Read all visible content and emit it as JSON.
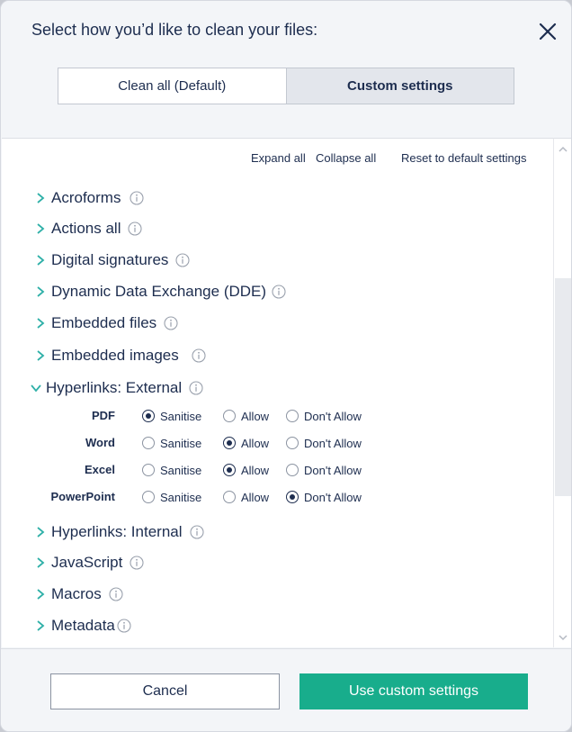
{
  "header": {
    "title": "Select how you’d like to clean your files:",
    "tabs": [
      "Clean all (Default)",
      "Custom settings"
    ],
    "active_tab": "Custom settings"
  },
  "actions": {
    "expand_all": "Expand all",
    "collapse_all": "Collapse all",
    "reset": "Reset to default settings"
  },
  "categories": [
    {
      "label": "Acroforms",
      "expanded": false
    },
    {
      "label": "Actions all",
      "expanded": false
    },
    {
      "label": "Digital signatures",
      "expanded": false
    },
    {
      "label": "Dynamic Data Exchange (DDE)",
      "expanded": false
    },
    {
      "label": "Embedded files",
      "expanded": false
    },
    {
      "label": "Embedded images",
      "expanded": false
    },
    {
      "label": "Hyperlinks: External",
      "expanded": true
    },
    {
      "label": "Hyperlinks: Internal",
      "expanded": false
    },
    {
      "label": "JavaScript",
      "expanded": false
    },
    {
      "label": "Macros",
      "expanded": false
    },
    {
      "label": "Metadata",
      "expanded": false
    }
  ],
  "hyperlinks_external": {
    "options": [
      "Sanitise",
      "Allow",
      "Don't Allow"
    ],
    "rows": [
      {
        "file_type": "PDF",
        "selected": "Sanitise"
      },
      {
        "file_type": "Word",
        "selected": "Allow"
      },
      {
        "file_type": "Excel",
        "selected": "Allow"
      },
      {
        "file_type": "PowerPoint",
        "selected": "Don't Allow"
      }
    ]
  },
  "footer": {
    "cancel_label": "Cancel",
    "primary_label": "Use custom settings"
  },
  "colors": {
    "accent": "#18ad8c",
    "chevron": "#2fb0a8",
    "text": "#1d2d4f"
  }
}
